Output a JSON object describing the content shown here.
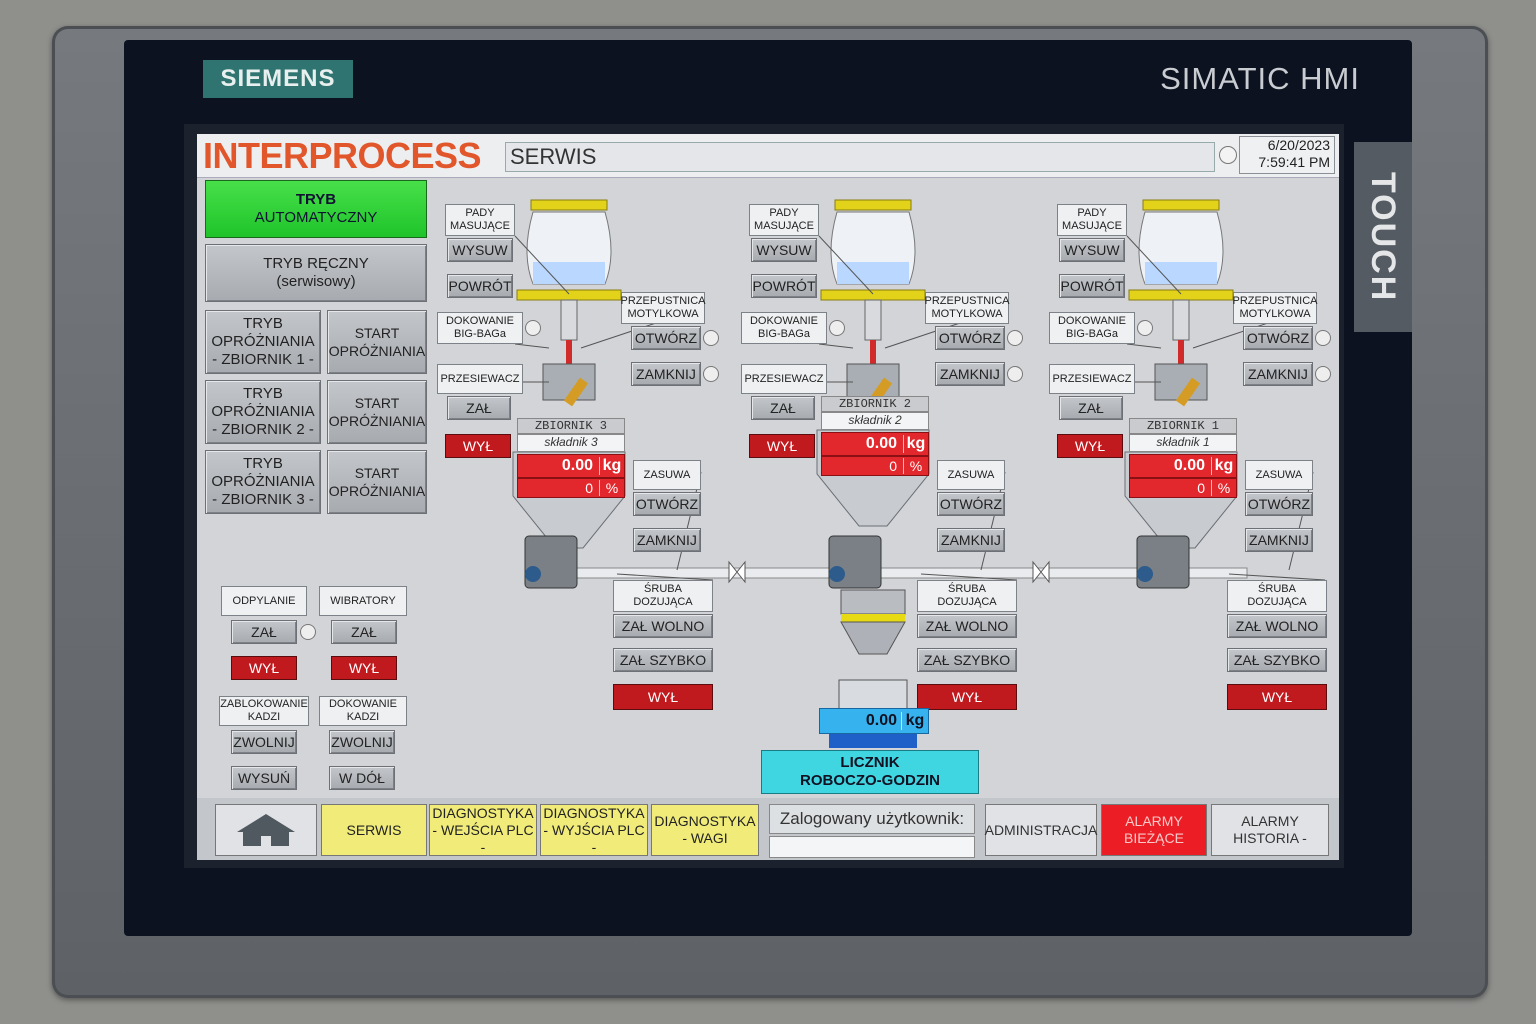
{
  "device": {
    "brand": "SIEMENS",
    "model": "SIMATIC HMI",
    "side_label": "TOUCH"
  },
  "header": {
    "brand": "INTERPROCESS",
    "screen_title": "SERWIS",
    "date": "6/20/2023",
    "time": "7:59:41 PM"
  },
  "modes": {
    "auto": [
      "TRYB",
      "AUTOMATYCZNY"
    ],
    "manual": [
      "TRYB RĘCZNY",
      "(serwisowy)"
    ],
    "empty_rows": [
      {
        "mode": [
          "TRYB",
          "OPRÓŻNIANIA",
          "- ZBIORNIK 1 -"
        ],
        "start": [
          "START",
          "OPRÓŻNIANIA"
        ]
      },
      {
        "mode": [
          "TRYB",
          "OPRÓŻNIANIA",
          "- ZBIORNIK 2 -"
        ],
        "start": [
          "START",
          "OPRÓŻNIANIA"
        ]
      },
      {
        "mode": [
          "TRYB",
          "OPRÓŻNIANIA",
          "- ZBIORNIK 3 -"
        ],
        "start": [
          "START",
          "OPRÓŻNIANIA"
        ]
      }
    ]
  },
  "aux": {
    "odpylanie": {
      "label": "ODPYLANIE",
      "on": "ZAŁ",
      "off": "WYŁ"
    },
    "wibratory": {
      "label": "WIBRATORY",
      "on": "ZAŁ",
      "off": "WYŁ"
    },
    "blokada": {
      "label": [
        "ZABLOKOWANIE",
        "KADZI"
      ],
      "release": "ZWOLNIJ",
      "extend": "WYSUŃ"
    },
    "dokowanie": {
      "label": [
        "DOKOWANIE",
        "KADZI"
      ],
      "release": "ZWOLNIJ",
      "down": "W DÓŁ"
    }
  },
  "stations": [
    {
      "pady": [
        "PADY",
        "MASUJĄCE"
      ],
      "wysuw": "WYSUW",
      "powrot": "POWRÓT",
      "dokowanie": [
        "DOKOWANIE",
        "BIG-BAGa"
      ],
      "przesiewacz": "PRZESIEWACZ",
      "zal": "ZAŁ",
      "wyl": "WYŁ",
      "przepustnica": [
        "PRZEPUSTNICA",
        "MOTYLKOWA"
      ],
      "otworz": "OTWÓRZ",
      "zamknij": "ZAMKNIJ",
      "tank": "ZBIORNIK 3",
      "ingredient": "składnik 3",
      "weight": "0.00",
      "weight_unit": "kg",
      "percent": "0",
      "percent_unit": "%",
      "zasuwa": "ZASUWA",
      "zasuwa_open": "OTWÓRZ",
      "zasuwa_close": "ZAMKNIJ",
      "sruba": [
        "ŚRUBA",
        "DOZUJĄCA"
      ],
      "slow": "ZAŁ WOLNO",
      "fast": "ZAŁ SZYBKO",
      "screw_off": "WYŁ"
    },
    {
      "pady": [
        "PADY",
        "MASUJĄCE"
      ],
      "wysuw": "WYSUW",
      "powrot": "POWRÓT",
      "dokowanie": [
        "DOKOWANIE",
        "BIG-BAGa"
      ],
      "przesiewacz": "PRZESIEWACZ",
      "zal": "ZAŁ",
      "wyl": "WYŁ",
      "przepustnica": [
        "PRZEPUSTNICA",
        "MOTYLKOWA"
      ],
      "otworz": "OTWÓRZ",
      "zamknij": "ZAMKNIJ",
      "tank": "ZBIORNIK 2",
      "ingredient": "składnik 2",
      "weight": "0.00",
      "weight_unit": "kg",
      "percent": "0",
      "percent_unit": "%",
      "zasuwa": "ZASUWA",
      "zasuwa_open": "OTWÓRZ",
      "zasuwa_close": "ZAMKNIJ",
      "sruba": [
        "ŚRUBA",
        "DOZUJĄCA"
      ],
      "slow": "ZAŁ WOLNO",
      "fast": "ZAŁ SZYBKO",
      "screw_off": "WYŁ"
    },
    {
      "pady": [
        "PADY",
        "MASUJĄCE"
      ],
      "wysuw": "WYSUW",
      "powrot": "POWRÓT",
      "dokowanie": [
        "DOKOWANIE",
        "BIG-BAGa"
      ],
      "przesiewacz": "PRZESIEWACZ",
      "zal": "ZAŁ",
      "wyl": "WYŁ",
      "przepustnica": [
        "PRZEPUSTNICA",
        "MOTYLKOWA"
      ],
      "otworz": "OTWÓRZ",
      "zamknij": "ZAMKNIJ",
      "tank": "ZBIORNIK 1",
      "ingredient": "składnik 1",
      "weight": "0.00",
      "weight_unit": "kg",
      "percent": "0",
      "percent_unit": "%",
      "zasuwa": "ZASUWA",
      "zasuwa_open": "OTWÓRZ",
      "zasuwa_close": "ZAMKNIJ",
      "sruba": [
        "ŚRUBA",
        "DOZUJĄCA"
      ],
      "slow": "ZAŁ WOLNO",
      "fast": "ZAŁ SZYBKO",
      "screw_off": "WYŁ"
    }
  ],
  "scale": {
    "weight": "0.00",
    "unit": "kg"
  },
  "counter": [
    "LICZNIK",
    "ROBOCZO-GODZIN"
  ],
  "footer": {
    "home_icon": "home-icon",
    "serwis": "SERWIS",
    "diag_in": [
      "DIAGNOSTYKA",
      "- WEJŚCIA PLC -"
    ],
    "diag_out": [
      "DIAGNOSTYKA",
      "- WYJŚCIA PLC -"
    ],
    "diag_scale": [
      "DIAGNOSTYKA",
      "- WAGI"
    ],
    "user_label": "Zalogowany użytkownik:",
    "user_value": "",
    "admin": "ADMINISTRACJA",
    "alarms_current": [
      "ALARMY",
      "BIEŻĄCE"
    ],
    "alarms_history": [
      "ALARMY",
      "HISTORIA -"
    ]
  },
  "colors": {
    "accent_green": "#2bd034",
    "alarm_red": "#ec1d24",
    "warning_yellow": "#f1ec7a",
    "counter_cyan": "#3fd6e2",
    "brand_orange": "#e2562b"
  }
}
